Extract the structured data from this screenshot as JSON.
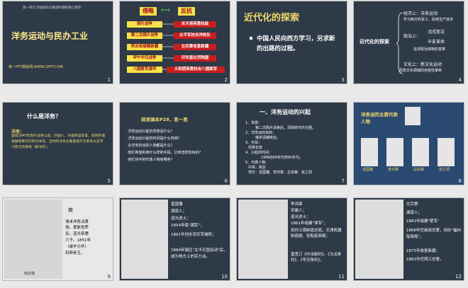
{
  "s1": {
    "subtitle": "第一单元 列强侵华与晚清时期的救亡图存",
    "title": "洋务运动与民办工业",
    "footer": "第一PPT模板网-WWW.1PPT.COM",
    "num": "1"
  },
  "s2": {
    "num": "2",
    "invade": "侵略",
    "arrow": "⟺",
    "resist": "反抗",
    "rows": [
      {
        "l": "鸦片战争",
        "r": "关天培英勇抗敌"
      },
      {
        "l": "第二次鸦片战争",
        "r": "太平军抗击洋枪队"
      },
      {
        "l": "阿古柏侵略新疆",
        "r": "左宗棠收复新疆"
      },
      {
        "l": "甲午中日战争",
        "r": "邓世昌壮烈殉国"
      },
      {
        "l": "八国联军侵华",
        "r": "义和团英勇抗击八国联军"
      }
    ]
  },
  "s3": {
    "num": "3",
    "title": "近代化的探索",
    "bullet": "中国人民向西方学习，另求新的出路的过程。"
  },
  "s4": {
    "num": "4",
    "root": "近代化的探索",
    "economy_label": "经济上：洋务运动",
    "economy_detail": "学习西方的军工、民用生产技术",
    "politics_label": "政治上：",
    "politics_1": "戊戌变法",
    "politics_2": "辛亥革命",
    "politics_detail": "追求政治体制的变革",
    "culture_label": "文化上：新文化运动",
    "culture_detail": "思想文化领域的自我性革命"
  },
  "s5": {
    "num": "5",
    "title": "什么是洋务？",
    "k": "洋务：",
    "body": "是指1840年鸦片战争以后，外国人、外国商品等等，如同外国接触等事均可称为洋务。当时的洋务主要是指外交事务以及学习西方的事情（即洋务）。"
  },
  "s6": {
    "num": "6",
    "title": "阅读课本P28，思一思",
    "qs": [
      "·洋务运动兴起的背景是什么？",
      "·洋务运动兴起的时间是什么时候？",
      "·办洋务的派别人物都是什么？",
      "·他们希望利用什么样的手段，达到怎样的目的？",
      "·他们当中的代表人物有哪些？"
    ]
  },
  "s7": {
    "num": "7",
    "title": "一、洋务运动的兴起",
    "lines": [
      "1、背景：",
      "第二次鸦片战争后，清政府内外交困。",
      "2、洋务派的目的：",
      "维护清朝统治。",
      "3、手段：",
      "师夷长技",
      "4、兴起的时间：",
      "19世纪60年代到90年代。",
      "5、代表人物：",
      "中央：奕訢",
      "地方：曾国藩、李鸿章、左宗棠、张之洞"
    ]
  },
  "s8": {
    "num": "8",
    "title": "洋务派的主要代表人物",
    "names": [
      "曾国藩",
      "李鸿章",
      "左宗棠",
      "张之洞"
    ]
  },
  "s9": {
    "num": "9",
    "name": "奕",
    "caption": "奕訢像",
    "lines": [
      "清末洋务派首",
      "领。爱新觉罗",
      "氏。道光帝第",
      "六子。1851年",
      "（咸丰元年）",
      "封恭亲王。"
    ]
  },
  "s10": {
    "num": "10",
    "lines": [
      "曾国藩",
      "湖南人；",
      "道光进士；",
      "1854年练\"湘军\"；",
      "1861年创办安庆军械所；",
      "1864年镇压\"太平天国运动\"后，成为地方上的实力派。"
    ]
  },
  "s11": {
    "num": "11",
    "lines": [
      "李鸿章",
      "安徽人；",
      "道光进士；",
      "1861年组建\"淮军\"；",
      "创办江南制造总局，天津机器制造局、轮船招商局；",
      "曾签订《中法新约》、《马关条约》、《辛丑条约》。"
    ]
  },
  "s12": {
    "num": "12",
    "lines": [
      "左宗棠",
      "湖南人；",
      "1861年组建\"楚军\"",
      "1866年任闽浙总督，创办\"福州船政局\"；",
      "1875年收复新疆；",
      "1881年任两江总督。"
    ]
  }
}
